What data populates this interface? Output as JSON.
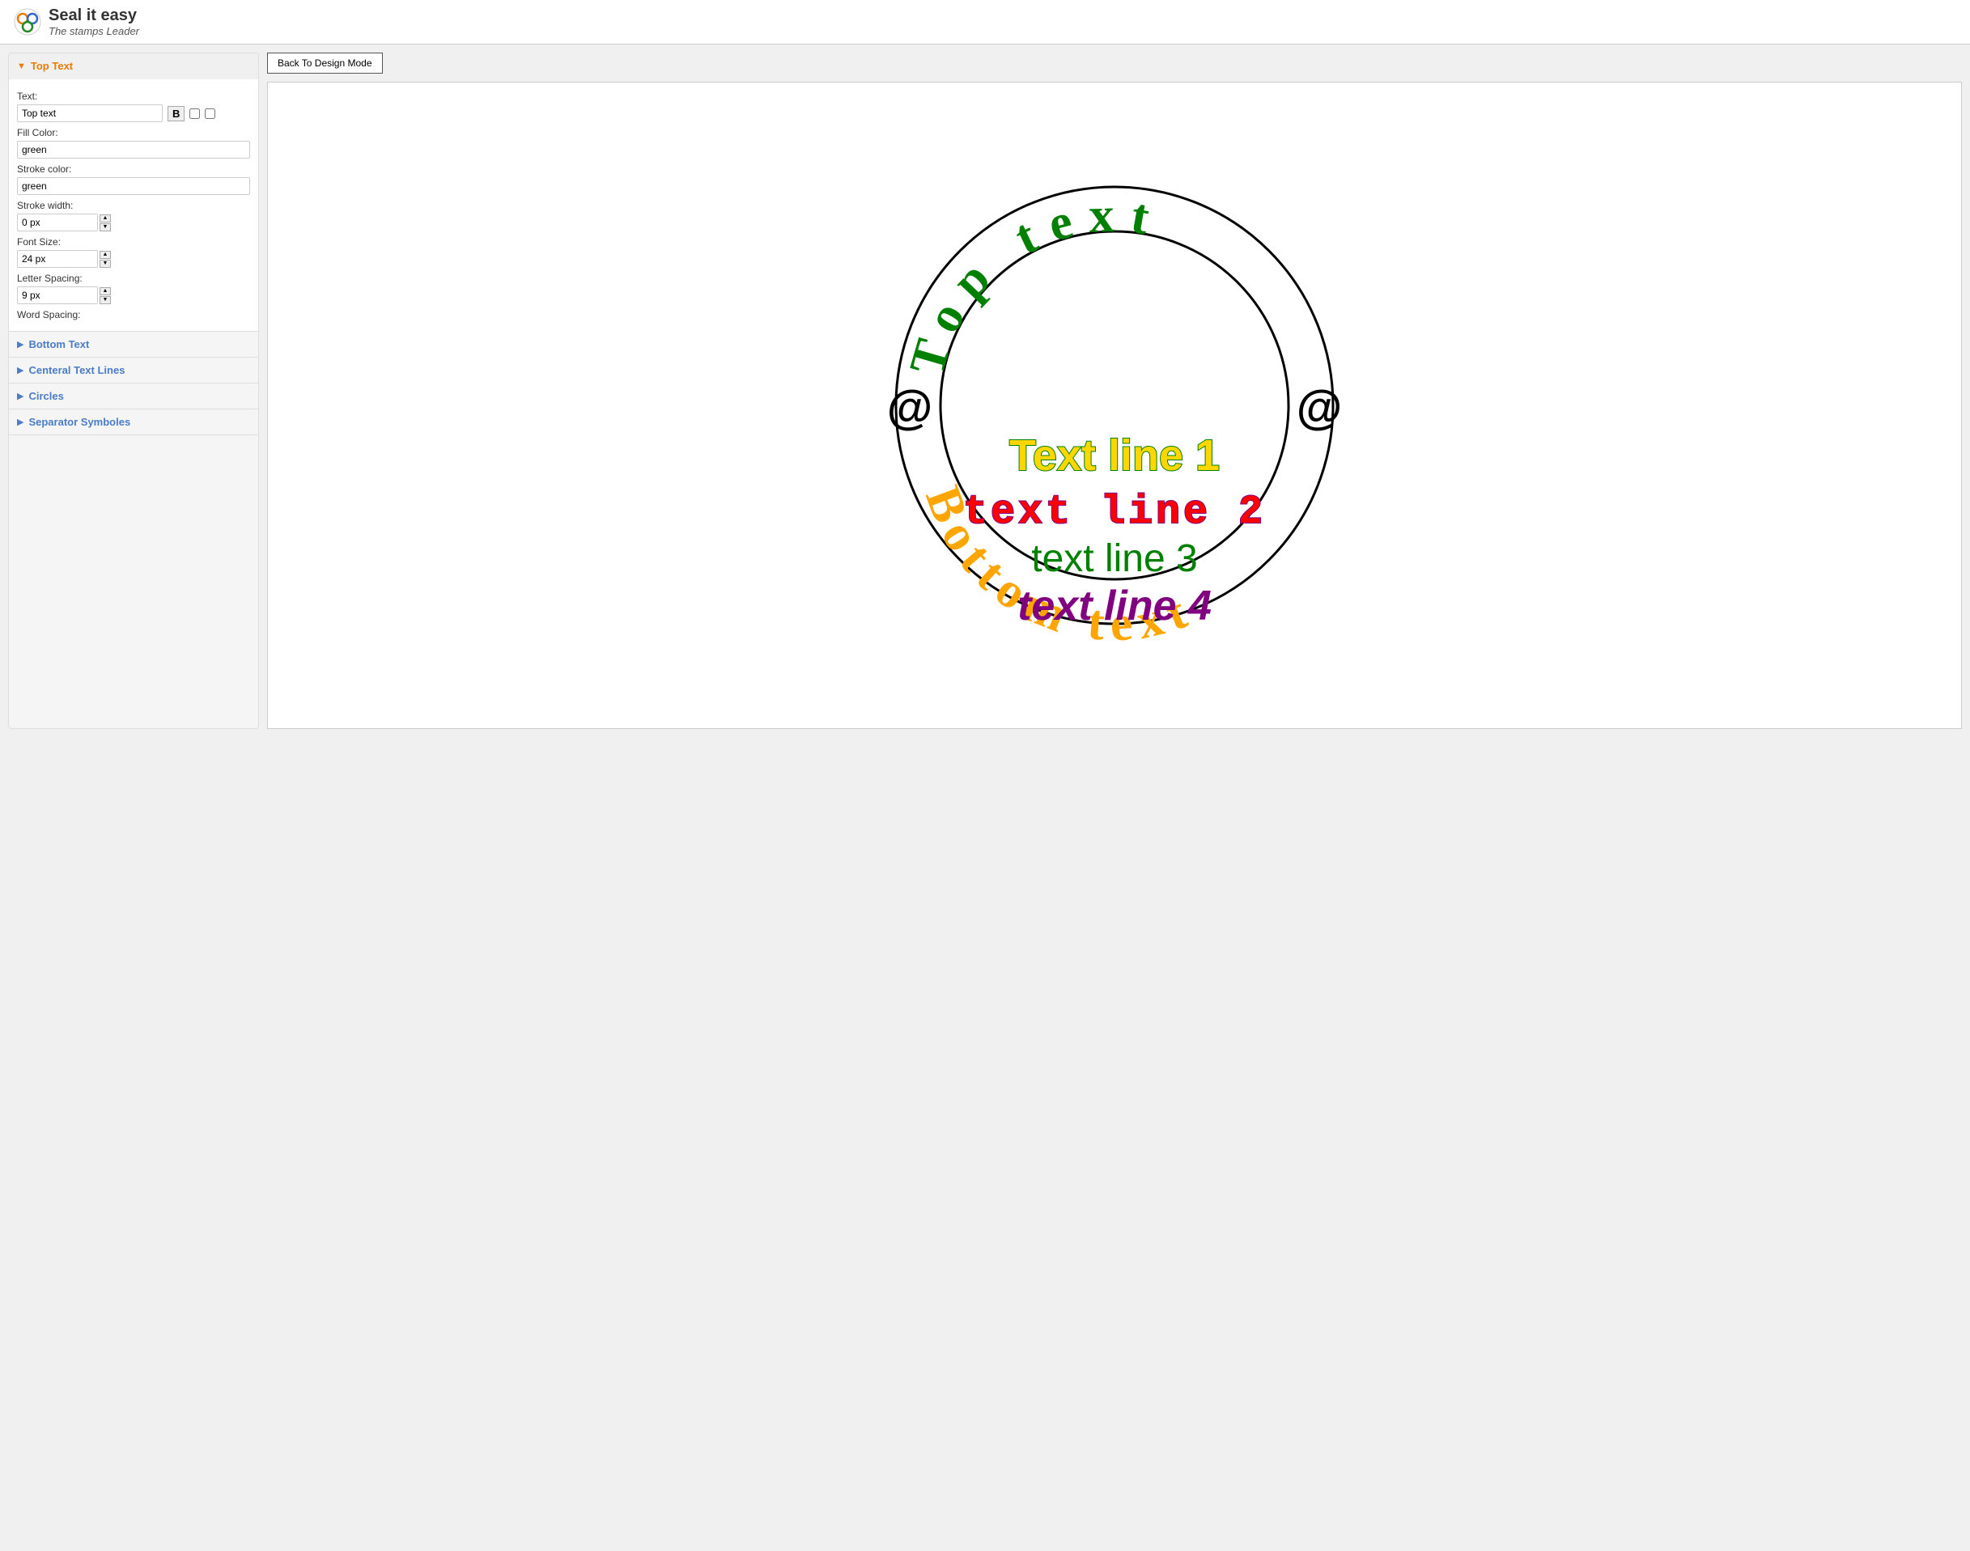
{
  "header": {
    "logo_title": "Seal it easy",
    "logo_subtitle": "The stamps Leader"
  },
  "back_button_label": "Back To Design Mode",
  "sidebar": {
    "top_text_section": {
      "title": "Top Text",
      "expanded": true,
      "fields": {
        "text_label": "Text:",
        "text_value": "Top text",
        "bold_label": "B",
        "fill_color_label": "Fill Color:",
        "fill_color_value": "green",
        "stroke_color_label": "Stroke color:",
        "stroke_color_value": "green",
        "stroke_width_label": "Stroke width:",
        "stroke_width_value": "0 px",
        "font_size_label": "Font Size:",
        "font_size_value": "24 px",
        "letter_spacing_label": "Letter Spacing:",
        "letter_spacing_value": "9 px",
        "word_spacing_label": "Word Spacing:"
      }
    },
    "bottom_text_section": {
      "title": "Bottom Text",
      "expanded": false
    },
    "central_text_section": {
      "title": "Centeral Text Lines",
      "expanded": false
    },
    "circles_section": {
      "title": "Circles",
      "expanded": false
    },
    "separator_section": {
      "title": "Separator Symboles",
      "expanded": false
    }
  },
  "seal": {
    "top_text": "Top text",
    "top_text_color": "#008000",
    "bottom_text": "Bottom text",
    "bottom_text_color": "#FFA500",
    "line1_text": "Text line 1",
    "line1_color": "#FFD700",
    "line1_stroke": "#008000",
    "line2_text": "text  line  2",
    "line2_color": "#FF0000",
    "line2_stroke": "#800080",
    "line3_text": "text line 3",
    "line3_color": "#008000",
    "line4_text": "text line 4",
    "line4_color": "#800080",
    "separator_symbol": "@"
  }
}
